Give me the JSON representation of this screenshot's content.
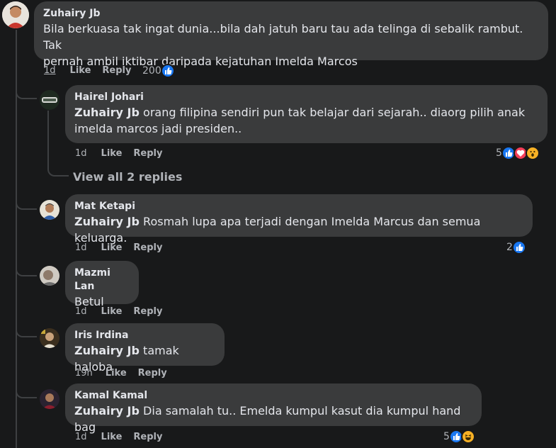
{
  "comments": [
    {
      "author": "Zuhairy Jb",
      "text": "Bila berkuasa tak ingat dunia...bila dah jatuh baru tau ada telinga di sebalik rambut. Tak pernah ambil iktibar daripada kejatuhan Imelda Marcos",
      "line1": "Bila berkuasa tak ingat dunia...bila dah jatuh baru tau ada telinga di sebalik rambut. Tak",
      "line2": "pernah ambil iktibar daripada kejatuhan Imelda Marcos",
      "time": "1d",
      "like": "Like",
      "reply": "Reply",
      "reaction_count": "200"
    },
    {
      "author": "Hairel Johari",
      "mention": "Zuhairy Jb",
      "line1": " orang filipina sendiri pun tak belajar dari sejarah.. diaorg pilih anak",
      "line2": "imelda marcos jadi presiden..",
      "time": "1d",
      "like": "Like",
      "reply": "Reply",
      "reaction_count": "5"
    },
    {
      "author": "Mat Ketapi",
      "mention": "Zuhairy Jb",
      "line1": " Rosmah lupa apa terjadi dengan Imelda Marcus dan semua keluarga.",
      "time": "1d",
      "like": "Like",
      "reply": "Reply",
      "reaction_count": "2"
    },
    {
      "author": "Mazmi Lan",
      "line1": "Betul",
      "time": "1d",
      "like": "Like",
      "reply": "Reply"
    },
    {
      "author": "Iris Irdina",
      "mention": "Zuhairy Jb",
      "line1": " tamak haloba",
      "time": "19h",
      "like": "Like",
      "reply": "Reply"
    },
    {
      "author": "Kamal Kamal",
      "mention": "Zuhairy Jb",
      "line1": " Dia samalah tu.. Emelda kumpul kasut dia kumpul hand bag",
      "time": "1d",
      "like": "Like",
      "reply": "Reply",
      "reaction_count": "5"
    }
  ],
  "view_all_replies": "View all 2 replies",
  "colors": {
    "background": "#18191a",
    "bubble": "#3a3b3c",
    "text": "#e4e6eb",
    "muted": "#b0b3b8",
    "like_blue": "#1877f2",
    "love_red": "#f33e58",
    "wow_yellow": "#f7b125"
  },
  "icons": [
    "like-icon",
    "love-icon",
    "wow-icon",
    "haha-icon"
  ]
}
